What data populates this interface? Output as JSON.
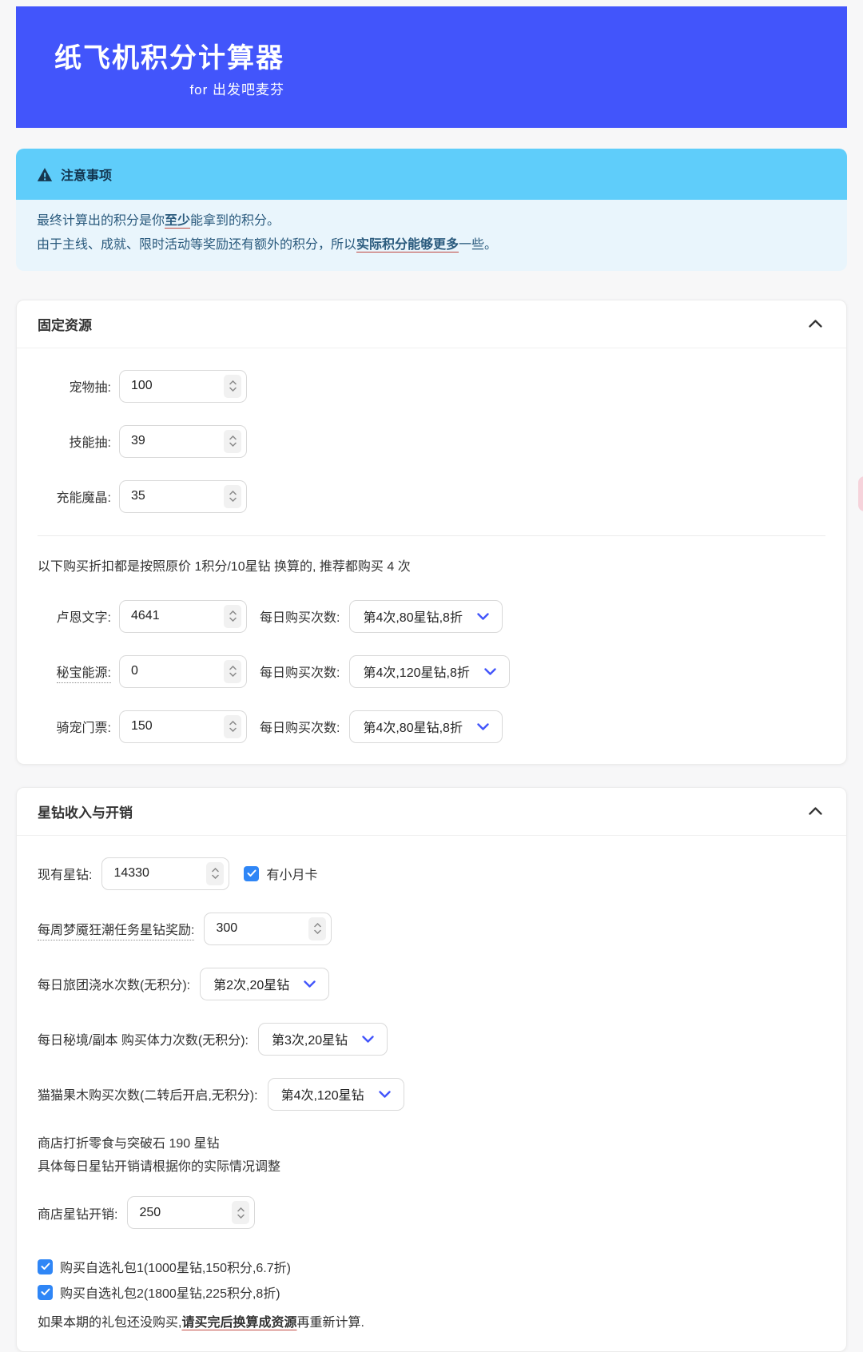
{
  "header": {
    "title": "纸飞机积分计算器",
    "subtitle": "for 出发吧麦芬"
  },
  "notice": {
    "title": "注意事项",
    "line1_pre": "最终计算出的积分是你",
    "line1_em": "至少",
    "line1_post": "能拿到的积分。",
    "line2_pre": "由于主线、成就、限时活动等奖励还有额外的积分，所以",
    "line2_em": "实际积分能够更多",
    "line2_post": "一些。"
  },
  "fixed_card": {
    "title": "固定资源",
    "fields": [
      {
        "label": "宠物抽:",
        "value": "100"
      },
      {
        "label": "技能抽:",
        "value": "39"
      },
      {
        "label": "充能魔晶:",
        "value": "35"
      }
    ],
    "note": "以下购买折扣都是按照原价 1积分/10星钻 换算的, 推荐都购买 4 次",
    "purchase_times_label": "每日购买次数:",
    "purchases": [
      {
        "label": "卢恩文字:",
        "value": "4641",
        "option": "第4次,80星钻,8折"
      },
      {
        "label": "秘宝能源:",
        "value": "0",
        "option": "第4次,120星钻,8折"
      },
      {
        "label": "骑宠门票:",
        "value": "150",
        "option": "第4次,80星钻,8折"
      }
    ]
  },
  "diamond_card": {
    "title": "星钻收入与开销",
    "current": {
      "label": "现有星钻:",
      "value": "14330",
      "checkbox_label": "有小月卡",
      "checked": true
    },
    "weekly": {
      "label": "每周梦魇狂潮任务星钻奖励:",
      "value": "300"
    },
    "selects": [
      {
        "label": "每日旅团浇水次数(无积分):",
        "option": "第2次,20星钻"
      },
      {
        "label": "每日秘境/副本 购买体力次数(无积分):",
        "option": "第3次,20星钻"
      },
      {
        "label": "猫猫果木购买次数(二转后开启,无积分):",
        "option": "第4次,120星钻"
      }
    ],
    "shop_note1": "商店打折零食与突破石 190 星钻",
    "shop_note2": "具体每日星钻开销请根据你的实际情况调整",
    "shop": {
      "label": "商店星钻开销:",
      "value": "250"
    },
    "packs": [
      {
        "label": "购买自选礼包1(1000星钻,150积分,6.7折)",
        "checked": true
      },
      {
        "label": "购买自选礼包2(1800星钻,225积分,8折)",
        "checked": true
      }
    ],
    "final_pre": "如果本期的礼包还没购买,",
    "final_em": "请买完后换算成资源",
    "final_post": "再重新计算."
  },
  "colors": {
    "header_bg": "#4255fb",
    "notice_header_bg": "#5fcdfa",
    "notice_body_bg": "#e9f5fc",
    "notice_text": "#2a5a7d",
    "accent_blue": "#4255fb",
    "checkbox_blue": "#2f86f6",
    "underline_red": "#c0443c",
    "page_bg": "#f7f7f8"
  }
}
